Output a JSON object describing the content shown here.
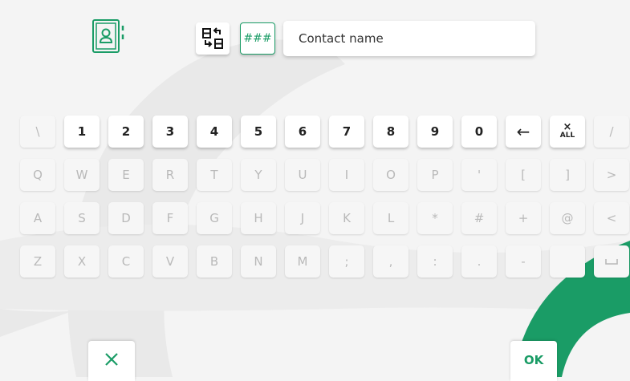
{
  "colors": {
    "accent": "#1a9c66",
    "background": "#f4f4f4",
    "key": "#ffffff",
    "key_disabled_text": "#b9b9b9"
  },
  "header": {
    "contacts_icon": "address-book-icon",
    "swap_icon": "swap-layout-icon",
    "numeric_mode_label": "###",
    "name_value": "Contact name"
  },
  "keyboard": {
    "row1": [
      "\\",
      "1",
      "2",
      "3",
      "4",
      "5",
      "6",
      "7",
      "8",
      "9",
      "0",
      "←",
      "",
      "/"
    ],
    "row1_clear_x": "×",
    "row1_clear_all": "ALL",
    "row2": [
      "Q",
      "W",
      "E",
      "R",
      "T",
      "Y",
      "U",
      "I",
      "O",
      "P",
      "'",
      "[",
      "]",
      ">"
    ],
    "row3": [
      "A",
      "S",
      "D",
      "F",
      "G",
      "H",
      "J",
      "K",
      "L",
      "*",
      "#",
      "+",
      "@",
      "<"
    ],
    "row4": [
      "Z",
      "X",
      "C",
      "V",
      "B",
      "N",
      "M",
      ";",
      ",",
      ":",
      ".",
      "-",
      "",
      "␣"
    ]
  },
  "footer": {
    "cancel_icon": "close-icon",
    "ok_label": "OK"
  }
}
